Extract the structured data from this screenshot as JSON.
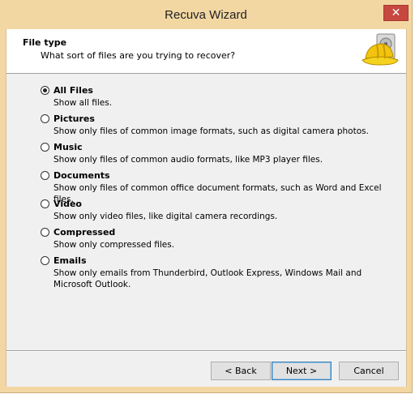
{
  "window": {
    "title": "Recuva Wizard",
    "close_glyph": "✕"
  },
  "header": {
    "title": "File type",
    "subtitle": "What sort of files are you trying to recover?",
    "logo_icon": "recuva-hardhat-icon"
  },
  "options": [
    {
      "label": "All Files",
      "desc": "Show all files.",
      "checked": true
    },
    {
      "label": "Pictures",
      "desc": "Show only files of common image formats, such as digital camera photos.",
      "checked": false
    },
    {
      "label": "Music",
      "desc": "Show only files of common audio formats, like MP3 player files.",
      "checked": false
    },
    {
      "label": "Documents",
      "desc": "Show only files of common office document formats, such as Word and Excel files.",
      "checked": false
    },
    {
      "label": "Video",
      "desc": "Show only video files, like digital camera recordings.",
      "checked": false
    },
    {
      "label": "Compressed",
      "desc": "Show only compressed files.",
      "checked": false
    },
    {
      "label": "Emails",
      "desc": "Show only emails from Thunderbird, Outlook Express, Windows Mail and Microsoft Outlook.",
      "checked": false
    }
  ],
  "buttons": {
    "back": "< Back",
    "next": "Next >",
    "cancel": "Cancel"
  },
  "colors": {
    "frame": "#f3d7a3",
    "close": "#c7483f",
    "client": "#f0f0f0"
  }
}
